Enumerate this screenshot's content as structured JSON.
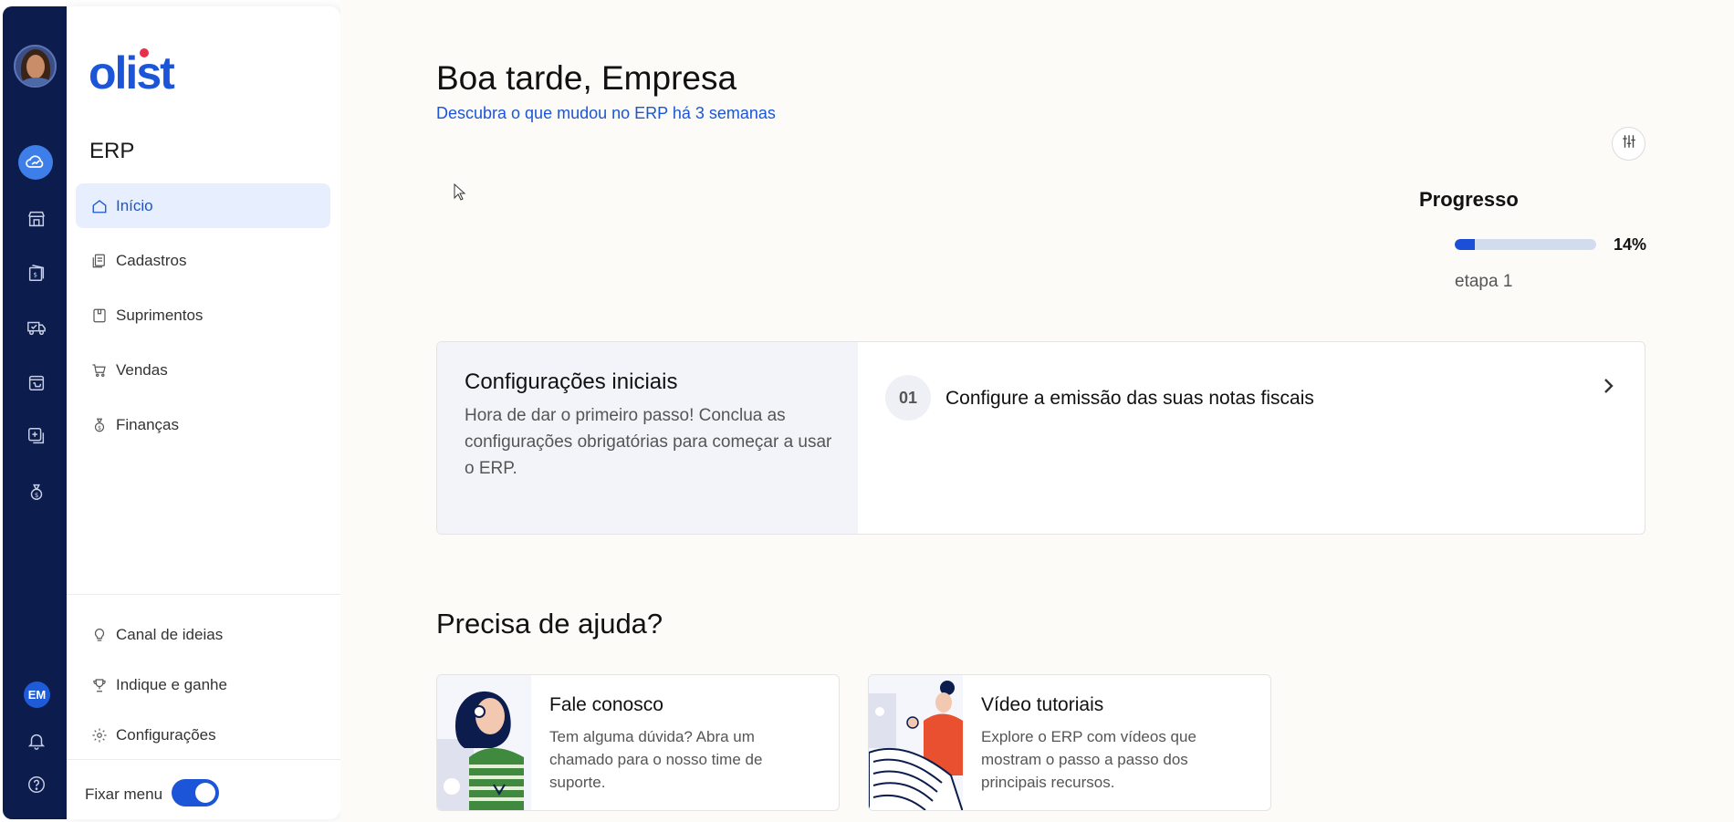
{
  "sidebar": {
    "brand": "olist",
    "section_title": "ERP",
    "nav_items": [
      {
        "label": "Início",
        "icon": "home-icon",
        "active": true
      },
      {
        "label": "Cadastros",
        "icon": "register-icon"
      },
      {
        "label": "Suprimentos",
        "icon": "box-icon"
      },
      {
        "label": "Vendas",
        "icon": "cart-icon"
      },
      {
        "label": "Finanças",
        "icon": "money-bag-icon"
      }
    ],
    "bottom_items": [
      {
        "label": "Canal de ideias",
        "icon": "lightbulb-icon"
      },
      {
        "label": "Indique e ganhe",
        "icon": "trophy-icon"
      },
      {
        "label": "Configurações",
        "icon": "gear-icon"
      }
    ],
    "pin_menu_label": "Fixar menu",
    "pin_menu_on": true
  },
  "rail": {
    "user_initials": "EM",
    "accent": "#3d7ee8",
    "icons": [
      "erp-icon",
      "store-icon",
      "money-icon",
      "delivery-icon",
      "shopping-icon",
      "add-app-icon",
      "finance-icon",
      "bell-icon",
      "help-icon"
    ]
  },
  "main": {
    "greeting": "Boa tarde, Empresa",
    "whats_new_link": "Descubra o que mudou no ERP há 3 semanas",
    "progress": {
      "title": "Progresso",
      "percent_label": "14%",
      "percent": 14,
      "stage": "etapa 1"
    },
    "config": {
      "title": "Configurações iniciais",
      "description": "Hora de dar o primeiro passo! Conclua as configurações obrigatórias para começar a usar o ERP.",
      "steps": [
        {
          "number": "01",
          "label": "Configure a emissão das suas notas fiscais"
        }
      ]
    },
    "help": {
      "title": "Precisa de ajuda?",
      "cards": [
        {
          "title": "Fale conosco",
          "description": "Tem alguma dúvida? Abra um chamado para o nosso time de suporte."
        },
        {
          "title": "Vídeo tutoriais",
          "description": "Explore o ERP com vídeos que mostram o passo a passo dos principais recursos."
        }
      ]
    }
  },
  "colors": {
    "brand_blue": "#1d55d8",
    "rail_bg": "#0c1c4c",
    "link_blue": "#1a56d6",
    "progress_fill": "#1d4ed8",
    "progress_track": "#d3dcef"
  }
}
